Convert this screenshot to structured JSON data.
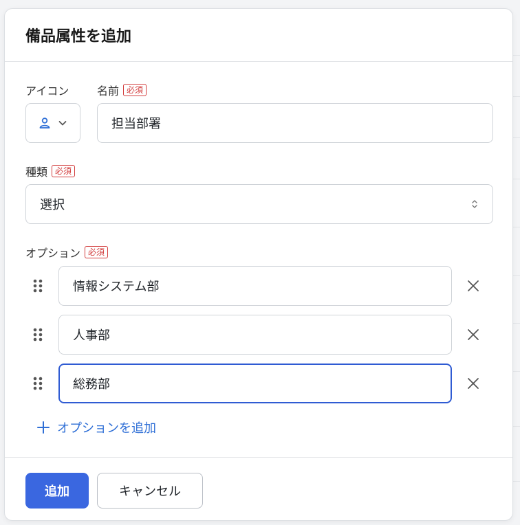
{
  "dialog": {
    "title": "備品属性を追加"
  },
  "form": {
    "icon_label": "アイコン",
    "icon_selected": "person-icon",
    "name_label": "名前",
    "required_badge": "必須",
    "name_value": "担当部署",
    "type_label": "種類",
    "type_value": "選択",
    "options_label": "オプション",
    "options": [
      {
        "value": "情報システム部"
      },
      {
        "value": "人事部"
      },
      {
        "value": "総務部"
      }
    ],
    "add_option_label": "オプションを追加"
  },
  "footer": {
    "add_button": "追加",
    "cancel_button": "キャンセル"
  },
  "colors": {
    "primary": "#3a67e0",
    "required": "#d23b3b",
    "link": "#2f6fd6",
    "focus": "#2f5bd3"
  }
}
